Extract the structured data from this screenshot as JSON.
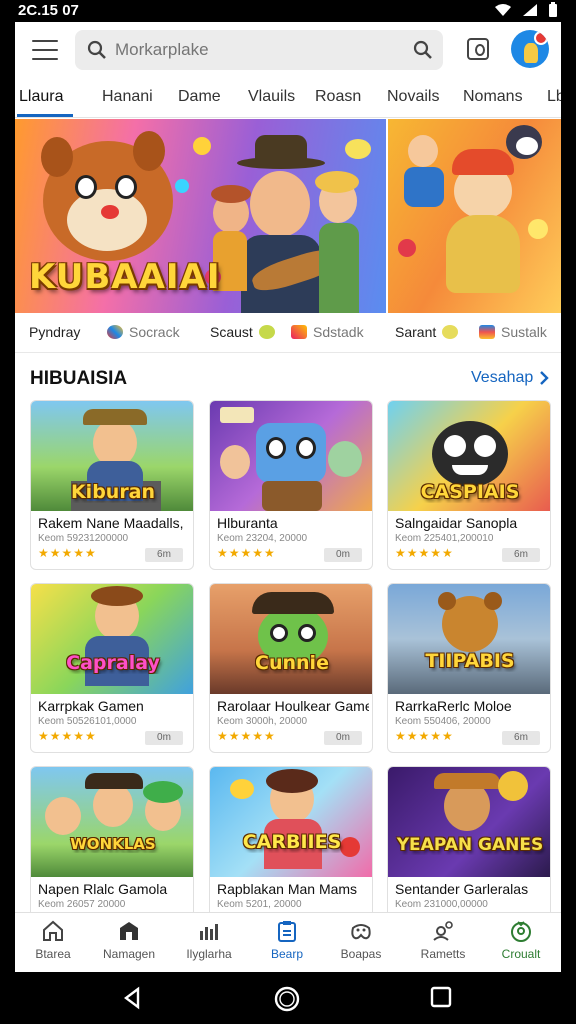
{
  "status_bar": {
    "time": "2C.15  07"
  },
  "top_bar": {
    "search_placeholder": "Morkarplake"
  },
  "tabs": [
    {
      "label": "Llaura"
    },
    {
      "label": "Hanani"
    },
    {
      "label": "Dame"
    },
    {
      "label": "Vlauils"
    },
    {
      "label": "Roasn"
    },
    {
      "label": "Novails"
    },
    {
      "label": "Nomans"
    },
    {
      "label": "Lb"
    }
  ],
  "banner": {
    "title": "KUBAAIAI"
  },
  "strip": [
    {
      "label": "Pyndray"
    },
    {
      "label": "Socrack"
    },
    {
      "label": "Scaust"
    },
    {
      "label": "Sdstadk"
    },
    {
      "label": "Sarant"
    },
    {
      "label": "Sustalk"
    }
  ],
  "section": {
    "title": "HIBUAISIA",
    "view_all": "Vesahap"
  },
  "cards": [
    {
      "thumb_title": "Kiburan",
      "name": "Rakem Nane Maadalls,",
      "meta": "Keom 59231200000",
      "stars": "★★★★★",
      "size": "6m"
    },
    {
      "thumb_title": "",
      "name": "Hlburanta",
      "meta": "Keom 23204, 20000",
      "stars": "★★★★★",
      "size": "0m"
    },
    {
      "thumb_title": "CASPIAIS",
      "name": "Salngaidar Sanopla",
      "meta": "Keom 225401,200010",
      "stars": "★★★★★",
      "size": "6m"
    },
    {
      "thumb_title": "Capralay",
      "name": "Karrpkak Gamen",
      "meta": "Keom 50526101,0000",
      "stars": "★★★★★",
      "size": "0m"
    },
    {
      "thumb_title": "Cunnie",
      "name": "Rarolaar Houlkear Game",
      "meta": "Keom 3000h, 20000",
      "stars": "★★★★★",
      "size": "0m"
    },
    {
      "thumb_title": "TIIPABIS",
      "name": "RarrkaRerlc Moloe",
      "meta": "Keom 550406, 20000",
      "stars": "★★★★★",
      "size": "6m"
    },
    {
      "thumb_title": "WONKLAS",
      "name": "Napen Rlalc Gamola",
      "meta": "Keom 26057 20000",
      "stars": "★★★★★",
      "size": ""
    },
    {
      "thumb_title": "CARBIIES",
      "name": "Rapblakan Man Mams",
      "meta": "Keom 5201, 20000",
      "stars": "★★★★★",
      "size": ""
    },
    {
      "thumb_title": "YEAPAN GANES",
      "name": "Sentander Garleralas",
      "meta": "Keom 231000,00000",
      "stars": "★★★★★",
      "size": ""
    }
  ],
  "bottom_nav": [
    {
      "label": "Btarea",
      "icon": "home-icon"
    },
    {
      "label": "Namagen",
      "icon": "store-icon"
    },
    {
      "label": "Ilyglarha",
      "icon": "chart-icon"
    },
    {
      "label": "Bearp",
      "icon": "clipboard-icon"
    },
    {
      "label": "Boapas",
      "icon": "gamepad-icon"
    },
    {
      "label": "Rametts",
      "icon": "alert-person-icon"
    },
    {
      "label": "Croualt",
      "icon": "circle-account-icon"
    }
  ],
  "colors": {
    "accent": "#1565c0",
    "active_green": "#2e7d32",
    "star": "#f2a900"
  }
}
